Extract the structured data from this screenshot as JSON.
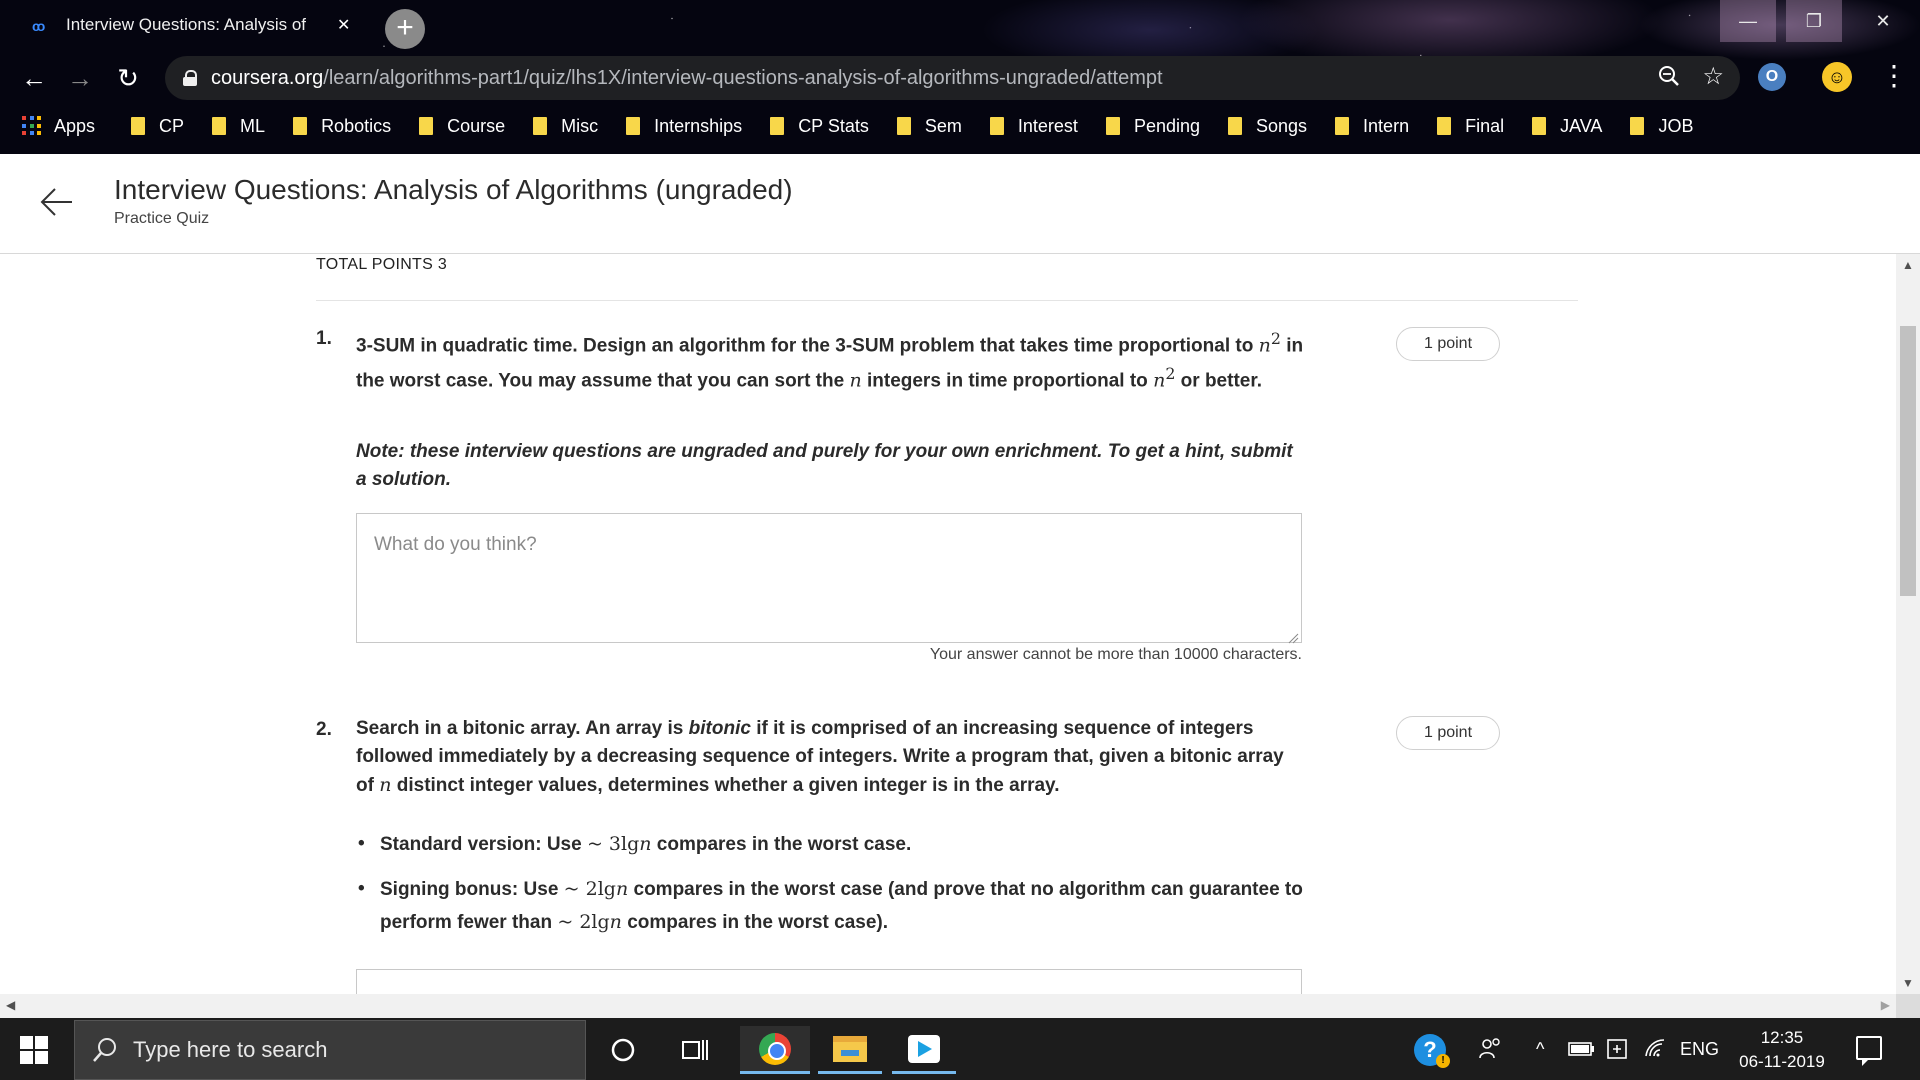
{
  "browser": {
    "tab_title": "Interview Questions: Analysis of",
    "tab_close": "✕",
    "new_tab": "+",
    "url_domain": "coursera.org",
    "url_path": "/learn/algorithms-part1/quiz/lhs1X/interview-questions-analysis-of-algorithms-ungraded/attempt",
    "bookmarks": [
      "Apps",
      "CP",
      "ML",
      "Robotics",
      "Course",
      "Misc",
      "Internships",
      "CP Stats",
      "Sem",
      "Interest",
      "Pending",
      "Songs",
      "Intern",
      "Final",
      "JAVA",
      "JOB"
    ]
  },
  "header": {
    "title": "Interview Questions: Analysis of Algorithms (ungraded)",
    "subtitle": "Practice Quiz"
  },
  "quiz": {
    "total_points": "TOTAL POINTS 3",
    "questions": [
      {
        "number": "1.",
        "points": "1 point",
        "text_a": "3-SUM in quadratic time. Design an algorithm for the 3-SUM problem that takes time proportional to ",
        "text_b": " in the worst case. You may assume that you can sort the ",
        "text_c": " integers in time proportional to ",
        "text_d": " or better.",
        "math_n2": "n",
        "math_sup": "2",
        "math_n": "n",
        "note": "Note: these interview questions are ungraded and purely for your own enrichment. To get a hint, submit a solution.",
        "placeholder": "What do you think?",
        "char_limit": "Your answer cannot be more than 10000 characters."
      },
      {
        "number": "2.",
        "points": "1 point",
        "text_a": "Search in a bitonic array. An array is ",
        "text_italic": "bitonic",
        "text_b": " if it is comprised of an increasing sequence of integers followed immediately by a decreasing sequence of integers. Write a program that, given a bitonic array of ",
        "math_n": "n",
        "text_c": " distinct integer values, determines whether a given integer is in the array.",
        "bullet1_a": "Standard version: Use ",
        "bullet1_math": "~ 3lg",
        "bullet1_b": " compares in the worst case.",
        "bullet2_a": "Signing bonus: Use ",
        "bullet2_math": "~ 2lg",
        "bullet2_b": " compares in the worst case (and prove that no algorithm can guarantee to perform fewer than ",
        "bullet2_math2": "~ 2lg",
        "bullet2_c": " compares in the worst case)."
      }
    ]
  },
  "taskbar": {
    "search_placeholder": "Type here to search",
    "language": "ENG",
    "time": "12:35",
    "date": "06-11-2019"
  }
}
